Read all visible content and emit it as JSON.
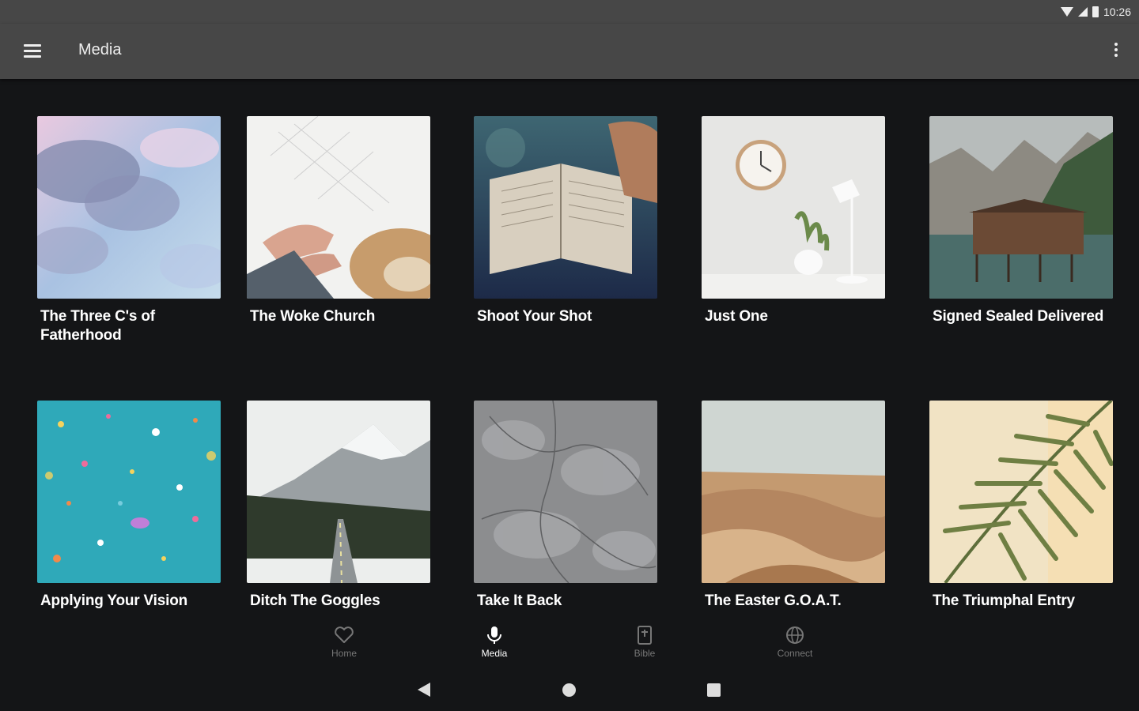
{
  "status": {
    "time": "10:26"
  },
  "appbar": {
    "title": "Media"
  },
  "items": [
    {
      "title": "The Three C's of Fatherhood"
    },
    {
      "title": "The Woke Church"
    },
    {
      "title": "Shoot Your Shot"
    },
    {
      "title": "Just One"
    },
    {
      "title": "Signed Sealed Delivered"
    },
    {
      "title": "Applying Your Vision"
    },
    {
      "title": "Ditch The Goggles"
    },
    {
      "title": "Take It Back"
    },
    {
      "title": "The Easter G.O.A.T."
    },
    {
      "title": "The Triumphal Entry"
    }
  ],
  "nav": [
    {
      "label": "Home",
      "icon": "heart-icon",
      "active": false
    },
    {
      "label": "Media",
      "icon": "microphone-icon",
      "active": true
    },
    {
      "label": "Bible",
      "icon": "bible-icon",
      "active": false
    },
    {
      "label": "Connect",
      "icon": "globe-icon",
      "active": false
    }
  ]
}
